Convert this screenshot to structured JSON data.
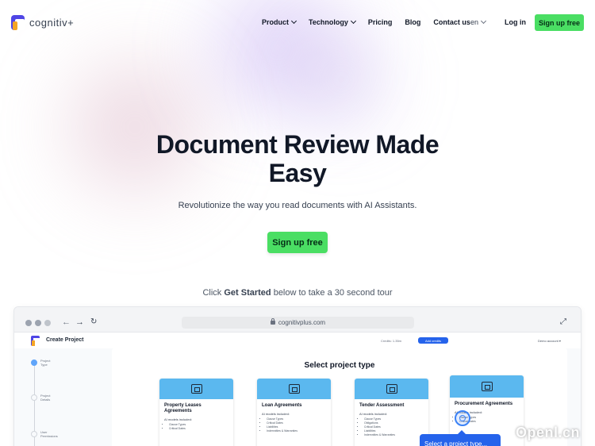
{
  "brand": {
    "name": "cognitiv+",
    "accent": "#4ade63",
    "logo_primary": "#4f46e5",
    "logo_secondary": "#f5a524"
  },
  "nav": {
    "items": [
      {
        "label": "Product",
        "has_dropdown": true
      },
      {
        "label": "Technology",
        "has_dropdown": true
      },
      {
        "label": "Pricing",
        "has_dropdown": false
      },
      {
        "label": "Blog",
        "has_dropdown": false
      },
      {
        "label": "Contact us",
        "has_dropdown": false
      }
    ],
    "language": "en",
    "login": "Log in",
    "signup": "Sign up free"
  },
  "hero": {
    "title_line1": "Document Review Made",
    "title_line2": "Easy",
    "subtitle": "Revolutionize the way you read documents with AI Assistants.",
    "cta": "Sign up free",
    "tour_prefix": "Click ",
    "tour_bold": "Get Started",
    "tour_suffix": " below to take a 30 second tour"
  },
  "demo": {
    "url": "cognitivplus.com",
    "app_title": "Create Project",
    "credits": "Credits: 1.35m",
    "add_credits": "Add credits",
    "account": "Demo account ▾",
    "steps": [
      "Project Type",
      "Project Details",
      "User Permissions"
    ],
    "panel_title": "Select project type",
    "cards": [
      {
        "title": "Property Leases Agreements",
        "sub": "AI models included:",
        "items": [
          "Clause Types",
          "Critical Dates"
        ]
      },
      {
        "title": "Loan Agreements",
        "sub": "AI models included:",
        "items": [
          "Clause Types",
          "Critical Dates",
          "Liabilities",
          "Indemnities & Warranties"
        ]
      },
      {
        "title": "Tender Assessment",
        "sub": "AI models included:",
        "items": [
          "Clause Types",
          "Obligations",
          "Critical Dates",
          "Liabilities",
          "Indemnities & Warranties"
        ]
      },
      {
        "title": "Procurement Agreements",
        "sub": "AI models included:",
        "items": [
          "Clause Types",
          "Critical Dates"
        ]
      }
    ],
    "tooltip": "Select a project type..."
  },
  "watermark": "Openl.cn"
}
